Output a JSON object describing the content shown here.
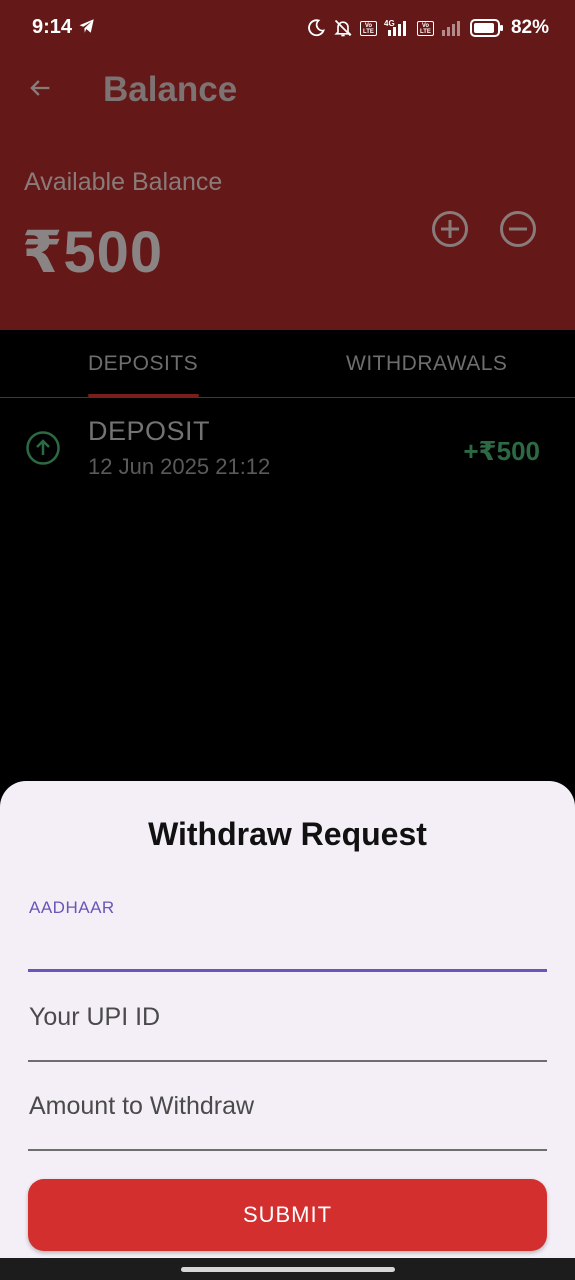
{
  "status_bar": {
    "time": "9:14",
    "battery_percent": "82%",
    "network": "4G",
    "volte_label": "Vo LTE",
    "icons": [
      "telegram-icon",
      "moon-icon",
      "bell-off-icon",
      "volte-icon",
      "signal-icon",
      "battery-icon"
    ]
  },
  "header": {
    "title": "Balance",
    "available_label": "Available Balance",
    "balance": "₹500",
    "back_icon": "arrow-left-icon",
    "add_icon": "plus-circle-icon",
    "withdraw_icon": "minus-circle-icon"
  },
  "tabs": [
    {
      "label": "DEPOSITS",
      "active": true
    },
    {
      "label": "WITHDRAWALS",
      "active": false
    }
  ],
  "transactions": [
    {
      "type": "DEPOSIT",
      "date": "12 Jun 2025 21:12",
      "amount": "+₹500",
      "icon": "arrow-up-circle-icon"
    }
  ],
  "withdraw_sheet": {
    "title": "Withdraw Request",
    "aadhaar_label": "AADHAAR",
    "aadhaar_value": "",
    "upi_placeholder": "Your UPI ID",
    "amount_placeholder": "Amount to Withdraw",
    "submit_label": "SUBMIT"
  },
  "colors": {
    "header_bg": "#641818",
    "accent_purple": "#6a55b8",
    "submit_red": "#d32f2f",
    "deposit_green": "#2c6a43",
    "sheet_bg": "#f4eff7"
  }
}
